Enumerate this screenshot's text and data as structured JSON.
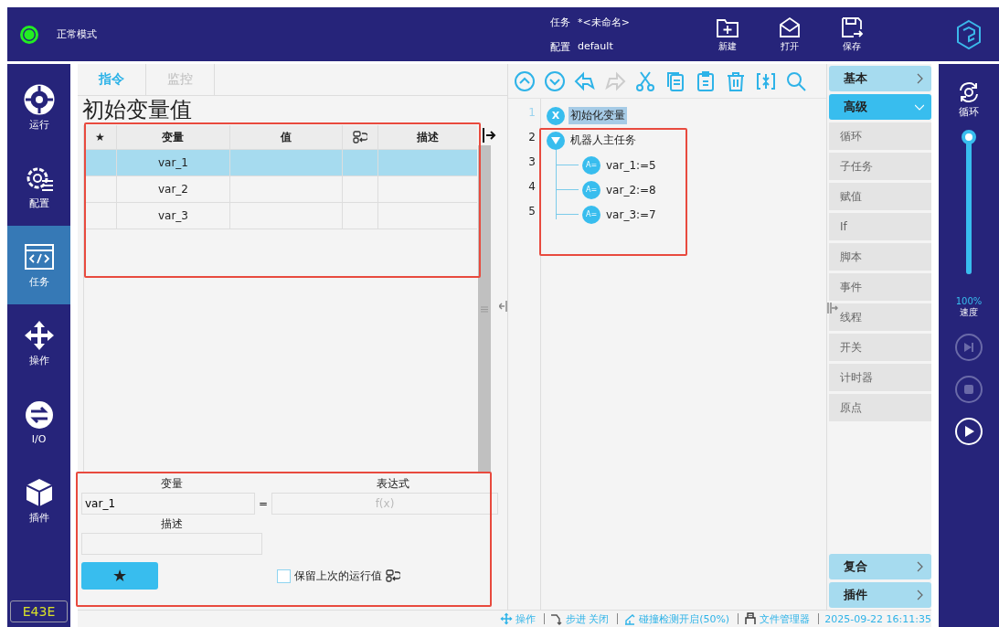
{
  "header": {
    "mode": {
      "label": "正常模式",
      "on": true
    },
    "task_label": "任务",
    "task_value": "*<未命名>",
    "config_label": "配置",
    "config_value": "default",
    "buttons": [
      {
        "kind": "new",
        "label": "新建"
      },
      {
        "kind": "open",
        "label": "打开"
      },
      {
        "kind": "save",
        "label": "保存"
      }
    ]
  },
  "nav": {
    "items": [
      {
        "kind": "run",
        "label": "运行",
        "selected": false
      },
      {
        "kind": "config",
        "label": "配置",
        "selected": false
      },
      {
        "kind": "task",
        "label": "任务",
        "selected": true
      },
      {
        "kind": "move",
        "label": "操作",
        "selected": false
      },
      {
        "kind": "io",
        "label": "I/O",
        "selected": false
      },
      {
        "kind": "plugin",
        "label": "插件",
        "selected": false
      }
    ],
    "code": "E43E"
  },
  "tabs": [
    {
      "label": "指令",
      "selected": true
    },
    {
      "label": "监控",
      "selected": false
    }
  ],
  "panel_title": "初始变量值",
  "table": {
    "columns": [
      "★",
      "变量",
      "值",
      "",
      "描述"
    ],
    "rows": [
      {
        "name": "var_1",
        "selected": true
      },
      {
        "name": "var_2",
        "selected": false
      },
      {
        "name": "var_3",
        "selected": false
      }
    ]
  },
  "form": {
    "variable_label": "变量",
    "variable_value": "var_1",
    "equals": "=",
    "expression_label": "表达式",
    "expression_placeholder": "f(x)",
    "description_label": "描述",
    "star_button": "★",
    "keep_value": {
      "label": "保留上次的运行值",
      "checked": false
    }
  },
  "editor": {
    "line_numbers": [
      "1",
      "2",
      "3",
      "4",
      "5"
    ],
    "tree": [
      {
        "kind": "init",
        "badge": "X",
        "label": "初始化变量",
        "selected": true
      },
      {
        "kind": "main",
        "label": "机器人主任务",
        "selected": false,
        "expanded": true,
        "children": [
          {
            "kind": "assign",
            "badge": "A=",
            "label": "var_1:=5",
            "selected": false
          },
          {
            "kind": "assign",
            "badge": "A=",
            "label": "var_2:=8",
            "selected": false
          },
          {
            "kind": "assign",
            "badge": "A=",
            "label": "var_3:=7",
            "selected": false
          }
        ]
      }
    ]
  },
  "palette": {
    "groups": [
      {
        "label": "基本",
        "expanded": false
      },
      {
        "label": "高级",
        "expanded": true,
        "items": [
          "循环",
          "子任务",
          "赋值",
          "If",
          "脚本",
          "事件",
          "线程",
          "开关",
          "计时器",
          "原点"
        ]
      },
      {
        "label": "复合",
        "expanded": false
      },
      {
        "label": "插件",
        "expanded": false
      }
    ]
  },
  "run_bar": {
    "loop_label": "循环",
    "speed": {
      "level": 1.0,
      "reading": "100%",
      "label": "速度"
    },
    "controls": [
      {
        "kind": "step",
        "disabled": true
      },
      {
        "kind": "stop",
        "disabled": true
      },
      {
        "kind": "play",
        "disabled": false
      }
    ]
  },
  "status_bar": [
    {
      "kind": "move",
      "label": "操作"
    },
    {
      "kind": "step",
      "label": "步进 关闭"
    },
    {
      "kind": "collision",
      "label": "碰撞检测开启(50%)"
    },
    {
      "kind": "files",
      "label": "文件管理器"
    },
    {
      "kind": "time",
      "label": "2025-09-22 16:11:35"
    }
  ]
}
